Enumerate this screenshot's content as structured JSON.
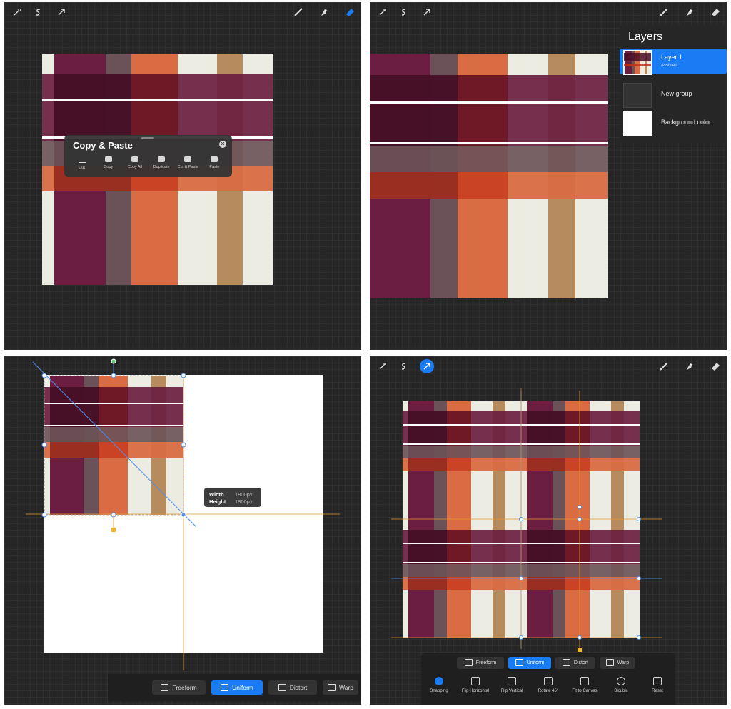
{
  "toolbar": {
    "left_tools": [
      "adjustments-icon",
      "selection-icon",
      "transform-arrow-icon"
    ],
    "right_tools": [
      "brush-icon",
      "smudge-icon",
      "eraser-icon"
    ],
    "accent": "#1a7cf5"
  },
  "panel1": {
    "copy_paste": {
      "title": "Copy & Paste",
      "items": [
        "Cut",
        "Copy",
        "Copy All",
        "Duplicate",
        "Cut & Paste",
        "Paste"
      ]
    }
  },
  "panel2": {
    "layers": {
      "title": "Layers",
      "rows": [
        {
          "name": "Layer 1",
          "sub": "Assisted",
          "selected": true
        },
        {
          "name": "New group",
          "sub": "",
          "selected": false
        },
        {
          "name": "Background color",
          "sub": "",
          "selected": false
        }
      ]
    }
  },
  "panel3": {
    "size": {
      "width_label": "Width",
      "width_value": "1800px",
      "height_label": "Height",
      "height_value": "1800px"
    },
    "modes": [
      "Freeform",
      "Uniform",
      "Distort",
      "Warp"
    ],
    "active_mode": "Uniform"
  },
  "panel4": {
    "modes": [
      "Freeform",
      "Uniform",
      "Distort",
      "Warp"
    ],
    "active_mode": "Uniform",
    "actions": [
      "Snapping",
      "Flip Horizontal",
      "Flip Vertical",
      "Rotate 45°",
      "Fit to Canvas",
      "Bicubic",
      "Reset"
    ]
  },
  "colors": {
    "plaid_cream": "#ecece2",
    "plaid_wine": "#6b1e3f",
    "plaid_mauve": "#6a5258",
    "plaid_orange": "#d96c42",
    "plaid_tan": "#b68b5e",
    "guide_orange": "#e8962a",
    "guide_blue": "#4d8ff0"
  }
}
